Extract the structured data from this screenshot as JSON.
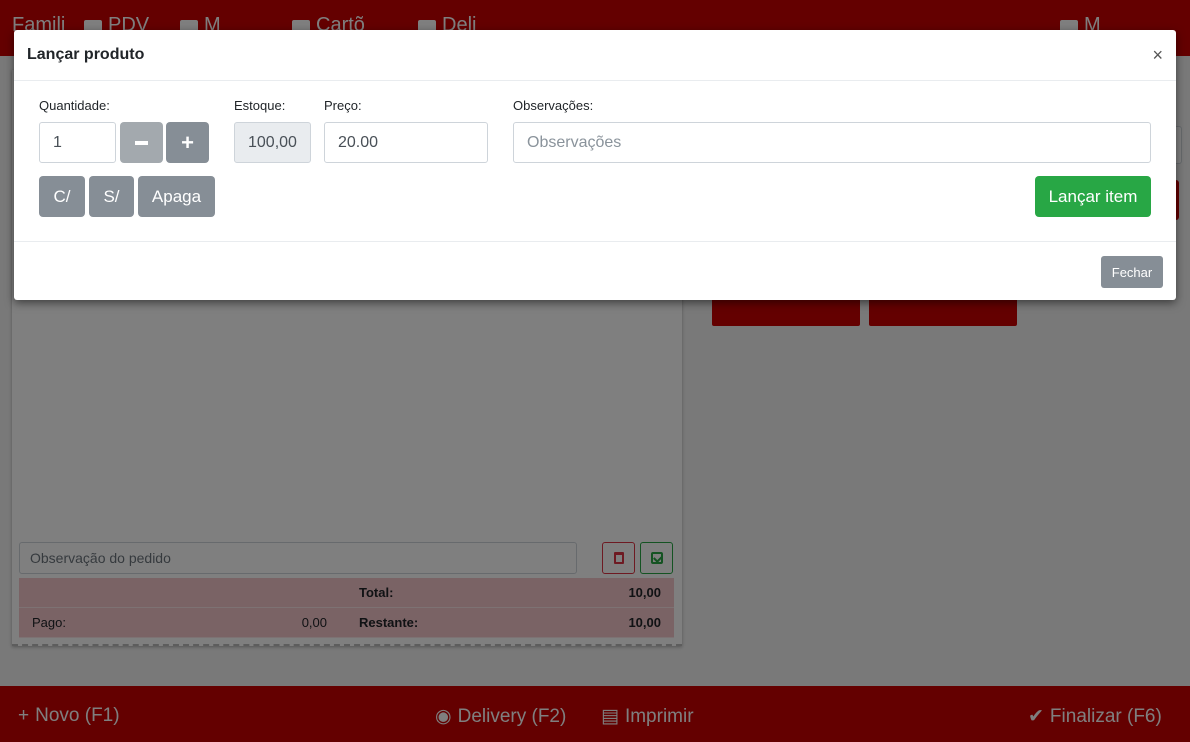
{
  "topnav": {
    "items": [
      "Famili",
      "PDV",
      "M",
      "Cartõ",
      "Deli",
      "M"
    ]
  },
  "order": {
    "observation_placeholder": "Observação do pedido",
    "paid_label": "Pago:",
    "paid_value": "0,00",
    "total_label": "Total:",
    "total_value": "10,00",
    "remaining_label": "Restante:",
    "remaining_value": "10,00"
  },
  "bottombar": {
    "new_label": "Novo (F1)",
    "delivery_label": "Delivery (F2)",
    "print_label": "Imprimir",
    "finish_label": "Finalizar (F6)"
  },
  "modal": {
    "title": "Lançar produto",
    "close": "×",
    "quantity_label": "Quantidade:",
    "quantity_value": "1",
    "stock_label": "Estoque:",
    "stock_value": "100,00",
    "price_label": "Preço:",
    "price_value": "20.00",
    "notes_label": "Observações:",
    "notes_placeholder": "Observações",
    "btn_with": "C/",
    "btn_without": "S/",
    "btn_clear": "Apaga",
    "btn_launch": "Lançar item",
    "btn_close": "Fechar"
  },
  "colors": {
    "brand_red": "#c80000",
    "success_green": "#28a745",
    "secondary_gray": "#868e96"
  }
}
